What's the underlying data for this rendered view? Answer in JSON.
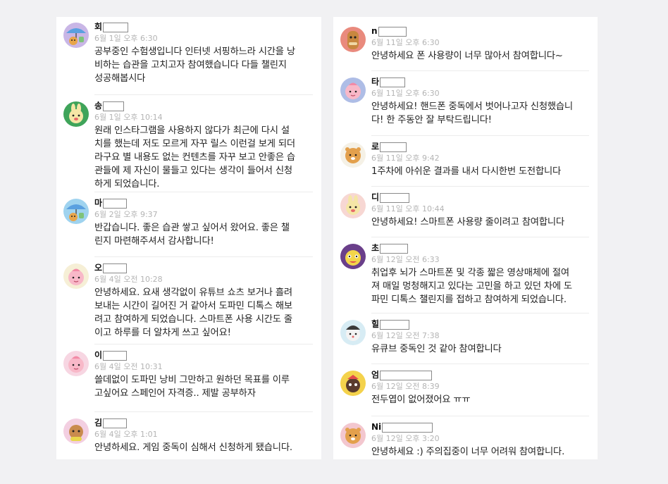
{
  "left_comments": [
    {
      "name": "회",
      "date": "6월 1일 오후 6:30",
      "text": "공부중인 수험생입니다 인터넷 서핑하느라 시간을 낭비하는 습관을 고치고자 참여했습니다 다들 챌린지 성공해봅시다",
      "avatar": "ryan-umbrella-icon",
      "avatar_bg": "#c9b6e6"
    },
    {
      "name": "송",
      "date": "6월 1일 오후 10:14",
      "text": "원래 인스타그램을 사용하지 않다가 최근에 다시 설치를 했는데 저도 모르게 자꾸 릴스 이런걸 보게 되더라구요 별 내용도 없는 컨텐츠를 자꾸 보고 안좋은 습관들에 제 자신이 물들고 있다는 생각이 들어서 신청하게 되었습니다.",
      "avatar": "muzi-icon",
      "avatar_bg": "#3fa45a"
    },
    {
      "name": "마",
      "date": "6월 2일 오후 9:37",
      "text": "반갑습니다. 좋은 습관 쌓고 싶어서 왔어요. 좋은 챌린지 마련해주셔서 감사합니다!",
      "avatar": "ryan-umbrella-icon",
      "avatar_bg": "#9fd3ef"
    },
    {
      "name": "오",
      "date": "6월 4일 오전 10:28",
      "text": "안녕하세요. 요새 생각없이 유튜브 쇼츠 보거나 흘려보내는 시간이 길어진 거 같아서 도파민 디톡스 해보려고 참여하게 되었습니다. 스마트폰 사용 시간도 줄이고 하루를 더 알차게 쓰고 싶어요!",
      "avatar": "apeach-icon",
      "avatar_bg": "#f6efd6"
    },
    {
      "name": "이",
      "date": "6월 4일 오전 10:31",
      "text": " 쓸데없이 도파민 낭비 그만하고 원하던 목표를 이루고싶어요 스페인어 자격증.. 제발 공부하자",
      "avatar": "apeach-icon",
      "avatar_bg": "#f7d6e2"
    },
    {
      "name": "김",
      "date": "6월 4일 오후 1:01",
      "text": "안녕하세요. 게임 중독이 심해서 신청하게 됐습니다.",
      "avatar": "frodo-icon",
      "avatar_bg": "#f3cfe1"
    }
  ],
  "right_comments": [
    {
      "name": "n",
      "date": "6월 11일 오후 6:30",
      "text": "안녕하세요 폰 사용량이 너무 많아서 참여합니다~",
      "avatar": "jay-g-icon",
      "avatar_bg": "#e98a7d"
    },
    {
      "name": "타",
      "date": "6월 11일 오후 6:30",
      "text": "안녕하세요! 핸드폰 중독에서 벗어나고자 신청했습니다! 한 주동안 잘 부탁드립니다!",
      "avatar": "apeach-icon",
      "avatar_bg": "#aebde6"
    },
    {
      "name": "로",
      "date": "6월 11일 오후 9:42",
      "text": "1주차에 아쉬운 결과를 내서 다시한번 도전합니다",
      "avatar": "ryan-icon",
      "avatar_bg": "#f5f1e6"
    },
    {
      "name": "디",
      "date": "6월 11일 오후 10:44",
      "text": "안녕하세요! 스마트폰 사용량 줄이려고 참여합니다",
      "avatar": "muzi-icon",
      "avatar_bg": "#f7d7d3"
    },
    {
      "name": "초",
      "date": "6월 12일 오전 6:33",
      "text": "취업후 뇌가 스마트폰 및 각종 짧은 영상매체에 절여져 매일 멍청해지고 있다는 고민을 하고 있던 차에 도파민 디톡스 챌린지를 접하고 참여하게 되었습니다.",
      "avatar": "tube-icon",
      "avatar_bg": "#6a3f8a"
    },
    {
      "name": "힐",
      "date": "6월 12일 오전 7:38",
      "text": "유큐브 중독인 것 같아 참여합니다",
      "avatar": "neo-icon",
      "avatar_bg": "#d7ecf4"
    },
    {
      "name": "엄",
      "date": "6월 12일 오전 8:39",
      "text": "전두엽이 없어졌어요 ㅠㅠ",
      "avatar": "con-icon",
      "avatar_bg": "#f4d24c"
    },
    {
      "name": "Ni",
      "date": "6월 12일 오후 3:20",
      "text": "안녕하세요 :) 주의집중이 너무 어려워 참여합니다.",
      "avatar": "ryan-icon",
      "avatar_bg": "#f3c7cf"
    }
  ]
}
